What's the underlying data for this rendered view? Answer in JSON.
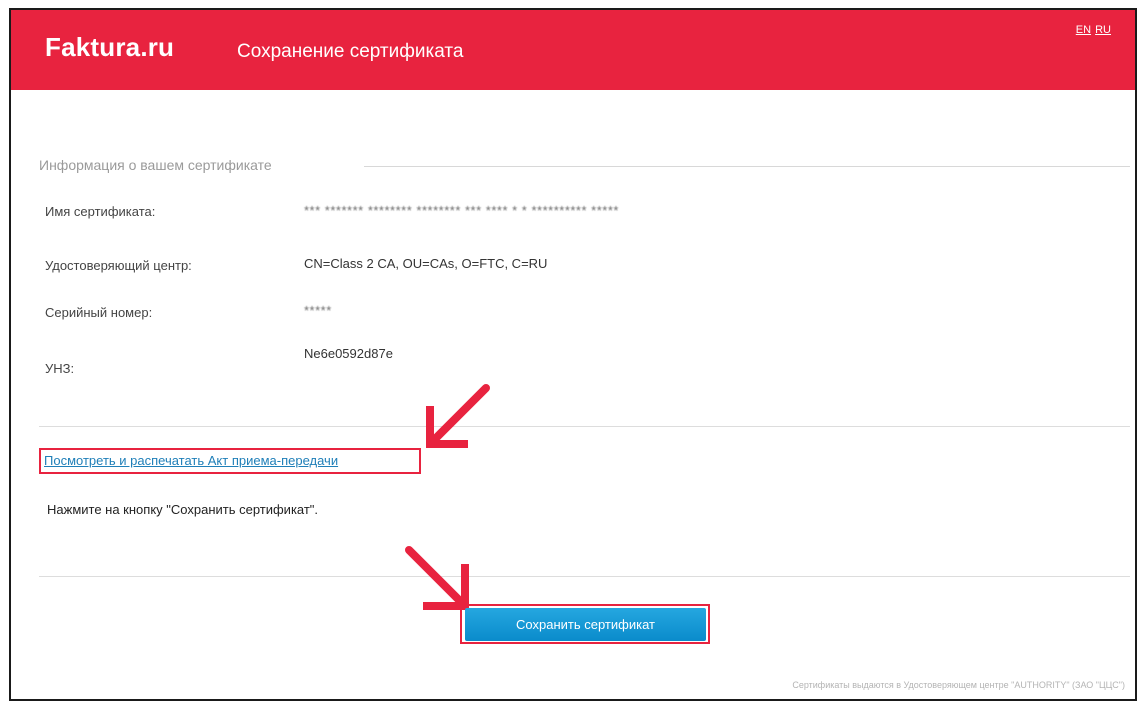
{
  "header": {
    "brand": "Faktura.ru",
    "title": "Сохранение сертификата",
    "lang_en": "EN",
    "lang_ru": "RU"
  },
  "certificate_info": {
    "legend": "Информация о вашем сертификате",
    "rows": [
      {
        "label": "Имя сертификата:",
        "value": "*** ******* ******** ******** *** **** * * ********** *****"
      },
      {
        "label": "Удостоверяющий центр:",
        "value": "CN=Class 2 CA, OU=CAs, O=FTC, C=RU"
      },
      {
        "label": "Серийный номер:",
        "value": "*****"
      },
      {
        "label": "УНЗ:",
        "value": "Ne6e0592d87e"
      }
    ]
  },
  "actions": {
    "view_act_link": "Посмотреть и распечатать Акт приема-передачи",
    "instruction": "Нажмите на кнопку \"Сохранить сертификат\".",
    "save_button": "Сохранить сертификат"
  },
  "footer": {
    "note": "Сертификаты выдаются в Удостоверяющем центре \"AUTHORITY\" (ЗАО \"ЦЦС\")"
  },
  "colors": {
    "brand_red": "#e8233f",
    "button_blue": "#129bd8",
    "link_blue": "#1f7fb8",
    "annotation_red": "#e8233f"
  }
}
